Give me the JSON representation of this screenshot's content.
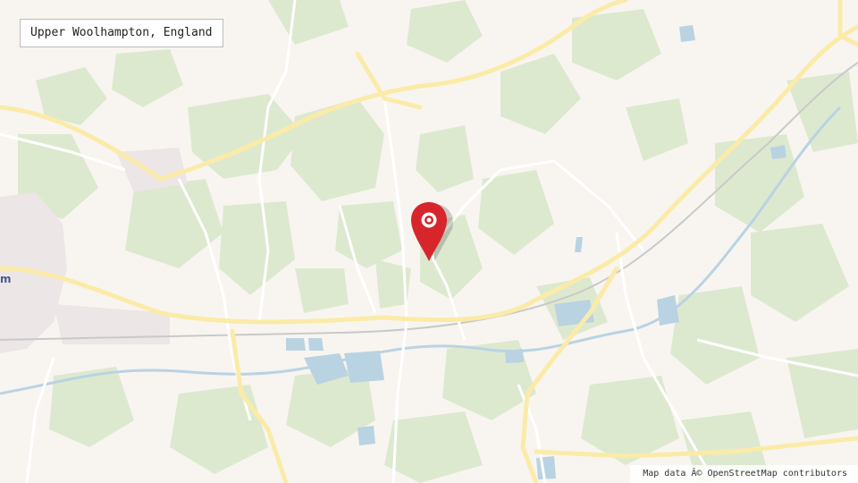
{
  "map": {
    "location_label": "Upper Woolhampton, England",
    "attribution": "Map data Â© OpenStreetMap contributors",
    "town_label_fragment": "m",
    "marker": {
      "icon": "map-pin-icon",
      "color": "#d7262b"
    },
    "colors": {
      "background": "#f8f5f0",
      "woodland": "#dde9cf",
      "water": "#b9d3e3",
      "major_road": "#fbeba8",
      "minor_road": "#ffffff",
      "urban": "#ece6e6",
      "rail": "#c9c9c9"
    }
  }
}
